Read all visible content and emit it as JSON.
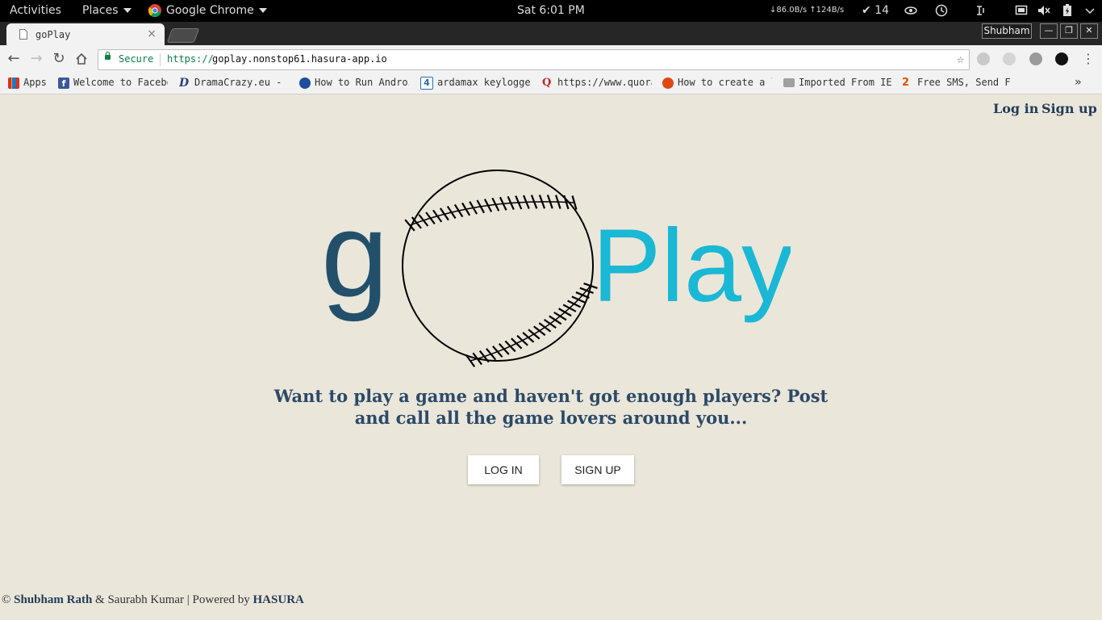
{
  "topbar": {
    "activities": "Activities",
    "places": "Places",
    "app": "Google Chrome",
    "clock": "Sat  6:01 PM",
    "net_speed": "↓86.0B/s ↑124B/s",
    "updates_count": "14"
  },
  "browser": {
    "tab_title": "goPlay",
    "tab_close": "×",
    "profile_name": "Shubham",
    "omnibox": {
      "secure_label": "Secure",
      "scheme": "https://",
      "host": "goplay.nonstop61.hasura-app.io"
    },
    "bookmarks": [
      {
        "label": "Apps",
        "icon": "apps-grid-icon"
      },
      {
        "label": "Welcome to Facebo",
        "icon": "facebook-icon"
      },
      {
        "label": "DramaCrazy.eu - D",
        "icon": "dramacrazy-icon"
      },
      {
        "label": "How to Run Androi",
        "icon": "globe-icon"
      },
      {
        "label": "ardamax keylogger",
        "icon": "four-icon"
      },
      {
        "label": "https://www.quora",
        "icon": "quora-icon"
      },
      {
        "label": "How to create a l",
        "icon": "ubuntu-icon"
      },
      {
        "label": "Imported From IE",
        "icon": "folder-icon"
      },
      {
        "label": "Free SMS, Send Fr",
        "icon": "way2sms-icon"
      }
    ],
    "bookmarks_overflow": "»"
  },
  "page": {
    "nav": {
      "login": "Log in",
      "signup": "Sign up"
    },
    "logo": {
      "letter": "g",
      "word": "Play",
      "letter_color": "#22506b",
      "word_color": "#1ab8d4"
    },
    "tagline": "Want to play a game and haven't got enough players? Post and call all the game lovers around you...",
    "buttons": {
      "login": "LOG IN",
      "signup": "SIGN UP"
    },
    "footer": {
      "copyright": "©",
      "author1": "Shubham Rath",
      "amp": " & Saurabh Kumar | Powered by ",
      "powered": "HASURA"
    }
  }
}
